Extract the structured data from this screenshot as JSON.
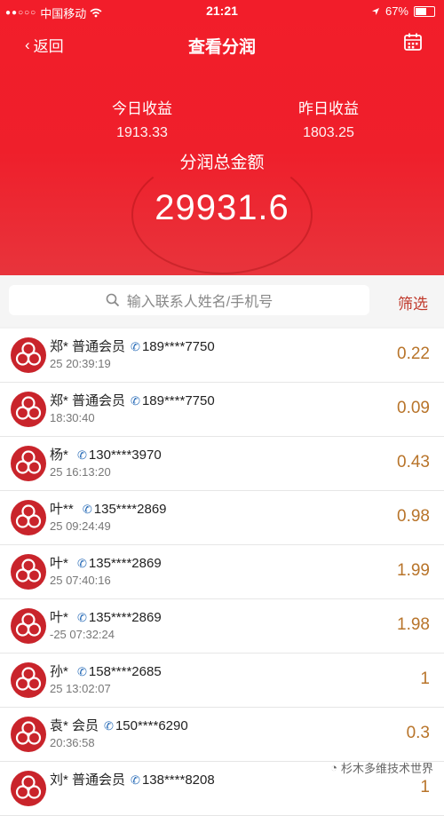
{
  "status_bar": {
    "carrier": "中国移动",
    "time": "21:21",
    "battery": "67%",
    "battery_level": 0.67
  },
  "nav": {
    "back_label": "返回",
    "title": "查看分润"
  },
  "stats": {
    "today_label": "今日收益",
    "today_value": "1913.33",
    "yesterday_label": "昨日收益",
    "yesterday_value": "1803.25",
    "total_label": "分润总金额",
    "total_value": "29931.6"
  },
  "search": {
    "placeholder": "输入联系人姓名/手机号",
    "filter_label": "筛选"
  },
  "rows": [
    {
      "name": "郑*",
      "level": "普通会员",
      "phone": "189****7750",
      "time": "25 20:39:19",
      "amount": "0.22"
    },
    {
      "name": "郑*",
      "level": "普通会员",
      "phone": "189****7750",
      "time": "18:30:40",
      "amount": "0.09"
    },
    {
      "name": "杨*",
      "level": "",
      "phone": "130****3970",
      "time": "25 16:13:20",
      "amount": "0.43"
    },
    {
      "name": "叶**",
      "level": "",
      "phone": "135****2869",
      "time": "25 09:24:49",
      "amount": "0.98"
    },
    {
      "name": "叶*",
      "level": "",
      "phone": "135****2869",
      "time": "25 07:40:16",
      "amount": "1.99"
    },
    {
      "name": "叶*",
      "level": "",
      "phone": "135****2869",
      "time": "-25 07:32:24",
      "amount": "1.98"
    },
    {
      "name": "孙*",
      "level": "",
      "phone": "158****2685",
      "time": "25 13:02:07",
      "amount": "1"
    },
    {
      "name": "袁*",
      "level": "会员",
      "phone": "150****6290",
      "time": "20:36:58",
      "amount": "0.3"
    },
    {
      "name": "刘*",
      "level": "普通会员",
      "phone": "138****8208",
      "time": "",
      "amount": "1"
    }
  ],
  "watermark": "杉木多维技术世界"
}
